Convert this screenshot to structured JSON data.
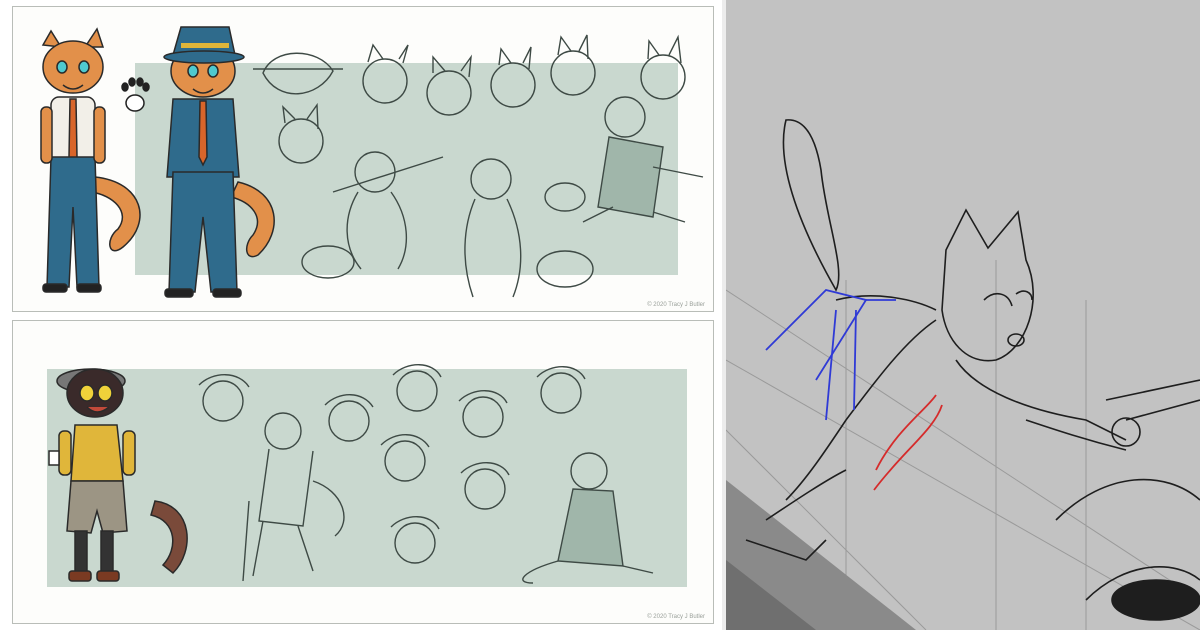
{
  "top_sheet": {
    "credit": "© 2020 Tracy J Butler"
  },
  "bottom_sheet": {
    "credit": "© 2020 Tracy J Butler"
  },
  "colors": {
    "sheet_bg": "#fdfdfb",
    "panel_green": "#c9d8cf",
    "sketch_line": "#3e4a45",
    "suit_blue": "#2f6b8c",
    "fur_orange": "#e2904a",
    "tie_orange": "#d8652a",
    "vest_yellow": "#e0b63a",
    "knickers_gray": "#9c9584",
    "canvas_gray": "#c2c2c2",
    "stroke_blue": "#2f3ad6",
    "stroke_red": "#d52b2b"
  }
}
